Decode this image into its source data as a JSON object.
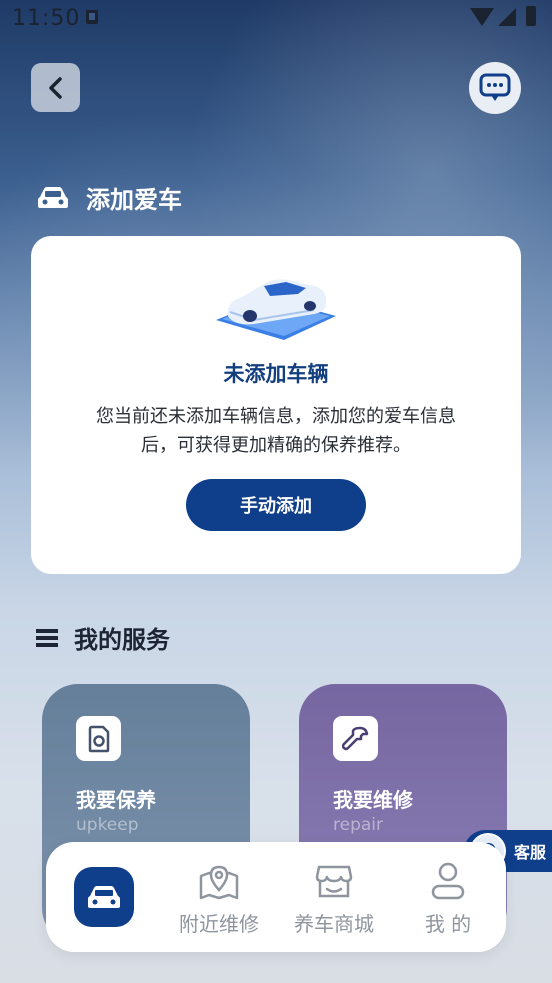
{
  "status_bar": {
    "time": "11:50"
  },
  "add_car": {
    "section_title": "添加爱车",
    "heading": "未添加车辆",
    "description": "您当前还未添加车辆信息，添加您的爱车信息后，可获得更加精确的保养推荐。",
    "button": "手动添加"
  },
  "services": {
    "section_title": "我的服务",
    "items": [
      {
        "name": "我要保养",
        "en": "upkeep",
        "icon": "maintenance-icon"
      },
      {
        "name": "我要维修",
        "en": "repair",
        "icon": "wrench-icon"
      }
    ]
  },
  "customer_service": {
    "label": "客服"
  },
  "tabbar": {
    "tabs": [
      {
        "label": "",
        "icon": "car-icon",
        "active": true
      },
      {
        "label": "附近维修",
        "icon": "map-pin-icon"
      },
      {
        "label": "养车商城",
        "icon": "store-icon"
      },
      {
        "label": "我 的",
        "icon": "user-icon"
      }
    ]
  },
  "colors": {
    "brand": "#0f3f8b",
    "upkeep_card": "#6f879f",
    "repair_card": "#7d6fa8"
  }
}
